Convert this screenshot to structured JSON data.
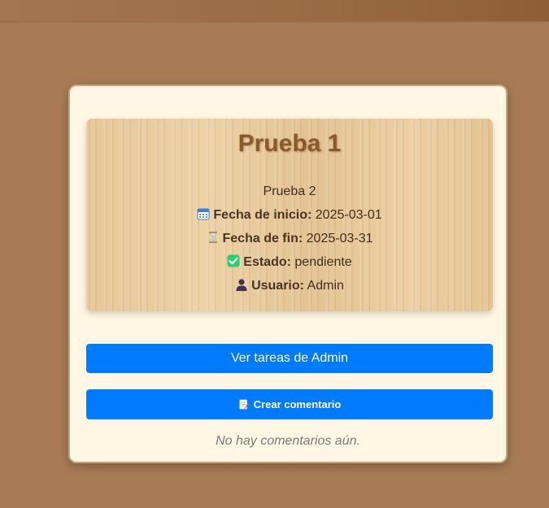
{
  "task": {
    "title": "Prueba 1",
    "description": "Prueba 2",
    "start_label": "Fecha de inicio:",
    "start_value": "2025-03-01",
    "end_label": "Fecha de fin:",
    "end_value": "2025-03-31",
    "status_label": "Estado:",
    "status_value": "pendiente",
    "user_label": "Usuario:",
    "user_value": "Admin"
  },
  "icons": {
    "start": "calendar-icon",
    "end": "hourglass-icon",
    "status": "check-mark-icon",
    "user": "user-icon",
    "comment": "memo-icon"
  },
  "actions": {
    "view_tasks_label": "Ver tareas de Admin",
    "create_comment_label": "Crear comentario"
  },
  "comments": {
    "empty_text": "No hay comentarios aún."
  },
  "colors": {
    "button": "#007bff",
    "title": "#8b5a2b",
    "status_check": "#2ecc71"
  }
}
